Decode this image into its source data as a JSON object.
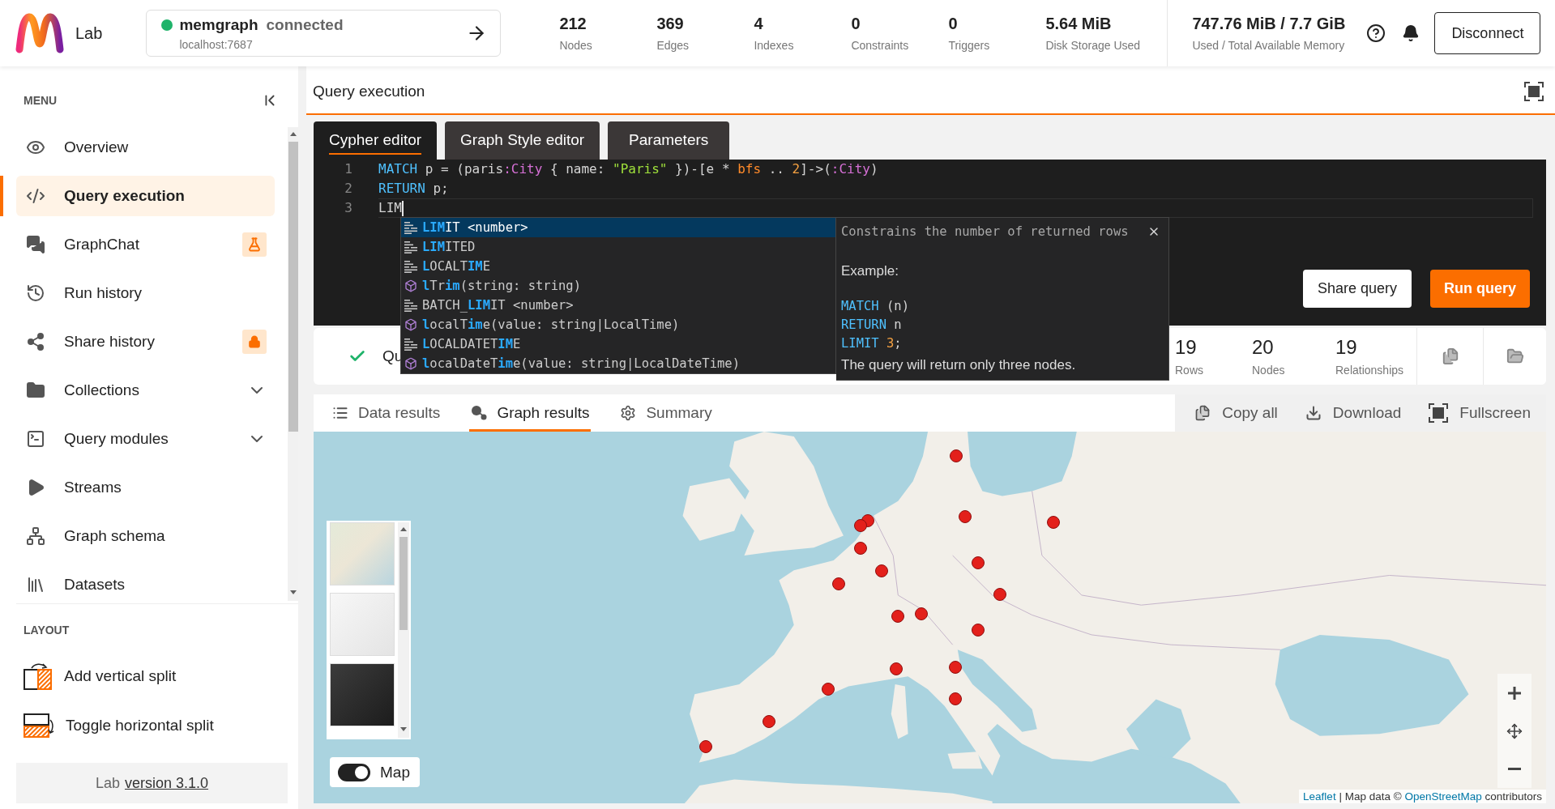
{
  "header": {
    "logo_text": "Lab",
    "connection": {
      "name": "memgraph",
      "status": "connected",
      "host": "localhost:7687",
      "online": true
    },
    "stats": [
      {
        "value": "212",
        "label": "Nodes"
      },
      {
        "value": "369",
        "label": "Edges"
      },
      {
        "value": "4",
        "label": "Indexes"
      },
      {
        "value": "0",
        "label": "Constraints"
      },
      {
        "value": "0",
        "label": "Triggers"
      },
      {
        "value": "5.64 MiB",
        "label": "Disk Storage Used"
      }
    ],
    "memory": {
      "value": "747.76 MiB / 7.7 GiB",
      "label": "Used / Total Available Memory"
    },
    "disconnect_button": "Disconnect"
  },
  "sidebar": {
    "menu_title": "MENU",
    "items": [
      {
        "label": "Overview",
        "kind": "link",
        "selected": false
      },
      {
        "label": "Query execution",
        "kind": "link",
        "selected": true
      },
      {
        "label": "GraphChat",
        "kind": "beta",
        "selected": false
      },
      {
        "label": "Run history",
        "kind": "link",
        "selected": false
      },
      {
        "label": "Share history",
        "kind": "locked",
        "selected": false
      },
      {
        "label": "Collections",
        "kind": "group",
        "selected": false,
        "expanded": false
      },
      {
        "label": "Query modules",
        "kind": "group",
        "selected": false,
        "expanded": false
      },
      {
        "label": "Streams",
        "kind": "link",
        "selected": false
      },
      {
        "label": "Graph schema",
        "kind": "link",
        "selected": false
      },
      {
        "label": "Datasets",
        "kind": "link",
        "selected": false
      }
    ],
    "layout_title": "LAYOUT",
    "layout_items": [
      {
        "label": "Add vertical split"
      },
      {
        "label": "Toggle horizontal split"
      }
    ],
    "footer": {
      "product": "Lab",
      "version_link": "version 3.1.0"
    }
  },
  "query": {
    "title": "Query execution",
    "editor_tabs": [
      {
        "label": "Cypher editor",
        "selected": true
      },
      {
        "label": "Graph Style editor",
        "selected": false
      },
      {
        "label": "Parameters",
        "selected": false
      }
    ],
    "code_lines": [
      {
        "number": "1",
        "current": false,
        "tokens": [
          {
            "text": "MATCH",
            "kind": "keyword"
          },
          {
            "text": " p = (paris",
            "kind": "plain"
          },
          {
            "text": ":City",
            "kind": "label"
          },
          {
            "text": " { name: ",
            "kind": "plain"
          },
          {
            "text": "\"Paris\"",
            "kind": "string"
          },
          {
            "text": " })-[e * ",
            "kind": "plain"
          },
          {
            "text": "bfs",
            "kind": "function"
          },
          {
            "text": " .. ",
            "kind": "plain"
          },
          {
            "text": "2",
            "kind": "number"
          },
          {
            "text": "]->(",
            "kind": "plain"
          },
          {
            "text": ":City",
            "kind": "label"
          },
          {
            "text": ")",
            "kind": "plain"
          }
        ]
      },
      {
        "number": "2",
        "current": false,
        "tokens": [
          {
            "text": "RETURN",
            "kind": "keyword"
          },
          {
            "text": " p;",
            "kind": "plain"
          }
        ]
      },
      {
        "number": "3",
        "current": true,
        "tokens": [
          {
            "text": "LIM",
            "kind": "plain"
          }
        ]
      }
    ],
    "autocomplete": {
      "items": [
        {
          "kind": "keyword",
          "text": "**LIM**IT <number>",
          "selected": true
        },
        {
          "kind": "keyword",
          "text": "**LIM**ITED",
          "selected": false
        },
        {
          "kind": "keyword",
          "text": "**L**OCALT**IM**E",
          "selected": false
        },
        {
          "kind": "function",
          "text": "**l**Tr**im**(string: string)",
          "selected": false
        },
        {
          "kind": "keyword",
          "text": "BATCH_**LIM**IT <number>",
          "selected": false
        },
        {
          "kind": "function",
          "text": "**l**ocalT**im**e(value: string|LocalTime)",
          "selected": false
        },
        {
          "kind": "keyword",
          "text": "**L**OCALDATET**IM**E",
          "selected": false
        },
        {
          "kind": "function",
          "text": "**l**ocalDateT**im**e(value: string|LocalDateTime)",
          "selected": false
        }
      ],
      "detail": {
        "description": "Constrains the number of returned rows",
        "example_title": "Example:",
        "example_lines": [
          [
            {
              "text": "MATCH",
              "kind": "keyword"
            },
            {
              "text": " (n)",
              "kind": "plain"
            }
          ],
          [
            {
              "text": "RETURN",
              "kind": "keyword"
            },
            {
              "text": " n",
              "kind": "plain"
            }
          ],
          [
            {
              "text": "LIMIT ",
              "kind": "keyword"
            },
            {
              "text": "3",
              "kind": "number"
            },
            {
              "text": ";",
              "kind": "plain"
            }
          ]
        ],
        "note": "The query will return only three nodes."
      }
    },
    "share_button": "Share query",
    "run_button": "Run query",
    "result_summary": {
      "success": true,
      "status_text": "Qu",
      "stats": [
        {
          "value": "19",
          "label": "Rows"
        },
        {
          "value": "20",
          "label": "Nodes"
        },
        {
          "value": "19",
          "label": "Relationships"
        }
      ]
    },
    "result_tabs": [
      {
        "label": "Data results",
        "selected": false
      },
      {
        "label": "Graph results",
        "selected": true
      },
      {
        "label": "Summary",
        "selected": false
      }
    ],
    "result_actions": [
      {
        "label": "Copy all"
      },
      {
        "label": "Download"
      },
      {
        "label": "Fullscreen"
      }
    ],
    "map": {
      "toggle": {
        "label": "Map",
        "on": true
      },
      "attribution": [
        {
          "text": "Leaflet",
          "link": true
        },
        {
          "text": " | Map data © ",
          "link": false
        },
        {
          "text": "OpenStreetMap",
          "link": true
        },
        {
          "text": " contributors",
          "link": false
        }
      ]
    }
  }
}
